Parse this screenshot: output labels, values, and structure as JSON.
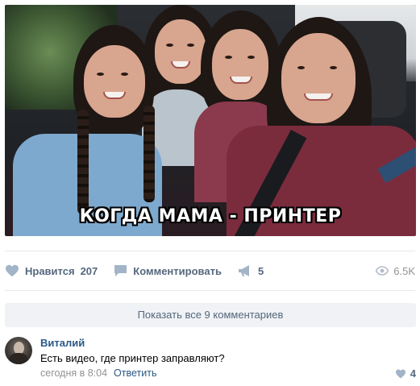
{
  "post": {
    "image_caption": "КОГДА МАМА - ПРИНТЕР",
    "actions": {
      "like_label": "Нравится",
      "like_count": "207",
      "comment_label": "Комментировать",
      "share_count": "5",
      "views": "6.5K"
    }
  },
  "comments": {
    "show_all_label": "Показать все 9 комментариев",
    "items": [
      {
        "author": "Виталий",
        "text": "Есть видео, где принтер заправляют?",
        "time": "сегодня в 8:04",
        "reply_label": "Ответить",
        "likes": "4"
      }
    ]
  },
  "icons": {
    "like": "heart-icon",
    "comment": "comment-bubble-icon",
    "share": "megaphone-icon",
    "views": "eye-icon"
  },
  "colors": {
    "accent": "#2a5885",
    "action_text": "#55677d",
    "muted": "#939393",
    "icon": "#a3b4c8"
  }
}
